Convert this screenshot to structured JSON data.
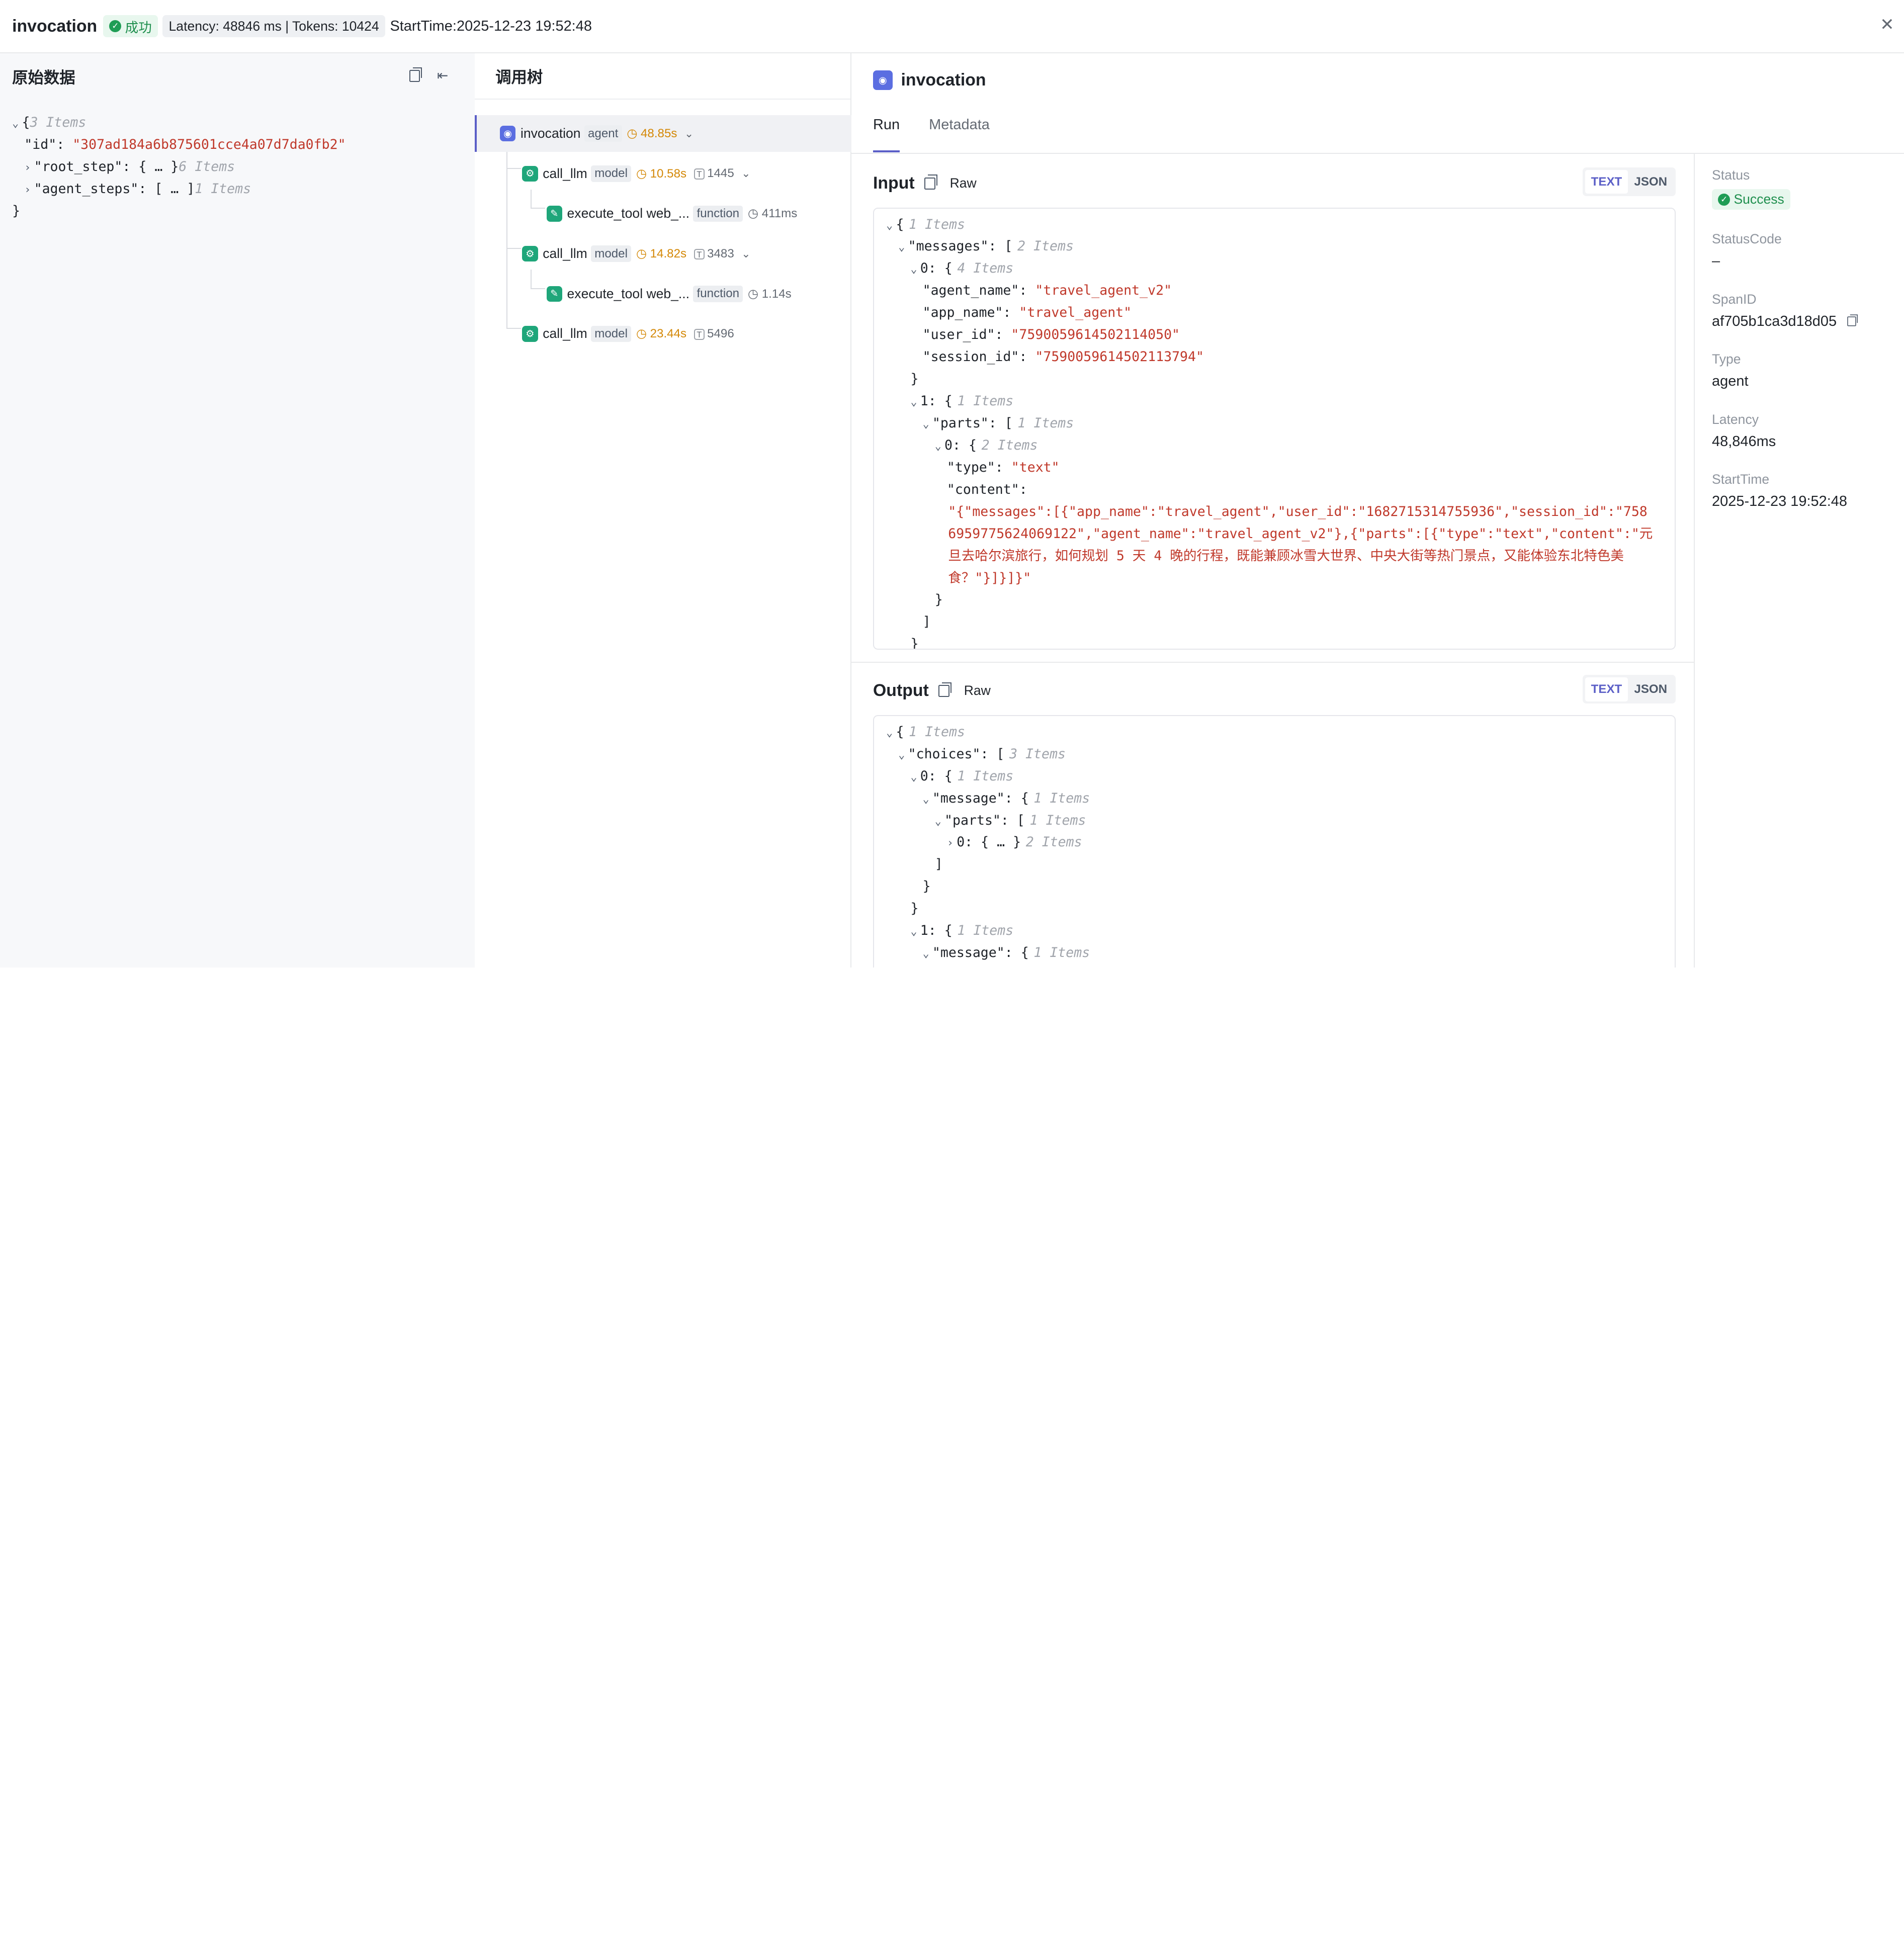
{
  "header": {
    "title": "invocation",
    "status": "成功",
    "metrics": "Latency: 48846 ms | Tokens: 10424",
    "start_time": "StartTime:2025-12-23 19:52:48",
    "close": "✕"
  },
  "raw": {
    "title": "原始数据",
    "lines": [
      {
        "tog": "⌄",
        "key": "{",
        "muted": "3 Items"
      },
      {
        "key": "\"id\": ",
        "str": "\"307ad184a6b875601cce4a07d7da0fb2\""
      },
      {
        "tog": "›",
        "key": "\"root_step\": { … }",
        "muted": "6 Items"
      },
      {
        "tog": "›",
        "key": "\"agent_steps\": [ … ]",
        "muted": "1 Items"
      },
      {
        "key": "}"
      }
    ]
  },
  "tree": {
    "title": "调用树",
    "nodes": [
      {
        "name": "invocation",
        "tag": "agent",
        "duration": "48.85s",
        "tokens": "",
        "icon": "agent-icon"
      },
      {
        "name": "call_llm",
        "tag": "model",
        "duration": "10.58s",
        "tokens": "1445",
        "icon": "model-icon"
      },
      {
        "name": "execute_tool web_...",
        "tag": "function",
        "duration": "411ms",
        "tokens": "",
        "icon": "tool-icon"
      },
      {
        "name": "call_llm",
        "tag": "model",
        "duration": "14.82s",
        "tokens": "3483",
        "icon": "model-icon"
      },
      {
        "name": "execute_tool web_...",
        "tag": "function",
        "duration": "1.14s",
        "tokens": "",
        "icon": "tool-icon"
      },
      {
        "name": "call_llm",
        "tag": "model",
        "duration": "23.44s",
        "tokens": "5496",
        "icon": "model-icon"
      }
    ]
  },
  "detail": {
    "title": "invocation",
    "tabs": [
      "Run",
      "Metadata"
    ],
    "input": {
      "label": "Input",
      "raw": "Raw",
      "text_btn": "TEXT",
      "json_btn": "JSON",
      "lines": [
        {
          "indent": 0,
          "tog": "⌄",
          "text": "{",
          "muted": "1 Items"
        },
        {
          "indent": 1,
          "tog": "⌄",
          "text": "\"messages\": [",
          "muted": "2 Items"
        },
        {
          "indent": 2,
          "tog": "⌄",
          "text": "0: {",
          "muted": "4 Items"
        },
        {
          "indent": 3,
          "key": "\"agent_name\": ",
          "str": "\"travel_agent_v2\""
        },
        {
          "indent": 3,
          "key": "\"app_name\": ",
          "str": "\"travel_agent\""
        },
        {
          "indent": 3,
          "key": "\"user_id\": ",
          "str": "\"7590059614502114050\""
        },
        {
          "indent": 3,
          "key": "\"session_id\": ",
          "str": "\"7590059614502113794\""
        },
        {
          "indent": 2,
          "text": "}"
        },
        {
          "indent": 2,
          "tog": "⌄",
          "text": "1: {",
          "muted": "1 Items"
        },
        {
          "indent": 3,
          "tog": "⌄",
          "text": "\"parts\": [",
          "muted": "1 Items"
        },
        {
          "indent": 4,
          "tog": "⌄",
          "text": "0: {",
          "muted": "2 Items"
        },
        {
          "indent": 5,
          "key": "\"type\": ",
          "str": "\"text\""
        },
        {
          "indent": 5,
          "key": "\"content\":"
        }
      ],
      "content_value": "\"{\"messages\":[{\"app_name\":\"travel_agent\",\"user_id\":\"1682715314755936\",\"session_id\":\"7586959775624069122\",\"agent_name\":\"travel_agent_v2\"},{\"parts\":[{\"type\":\"text\",\"content\":\"元旦去哈尔滨旅行，如何规划 5 天 4 晚的行程，既能兼顾冰雪大世界、中央大街等热门景点，又能体验东北特色美食？\"}]}]}\"",
      "tail": [
        {
          "indent": 4,
          "text": "}"
        },
        {
          "indent": 3,
          "text": "]"
        },
        {
          "indent": 2,
          "text": "}"
        },
        {
          "indent": 1,
          "text": "]"
        }
      ]
    },
    "output": {
      "label": "Output",
      "raw": "Raw",
      "text_btn": "TEXT",
      "json_btn": "JSON",
      "lines": [
        {
          "indent": 0,
          "tog": "⌄",
          "text": "{",
          "muted": "1 Items"
        },
        {
          "indent": 1,
          "tog": "⌄",
          "text": "\"choices\": [",
          "muted": "3 Items"
        },
        {
          "indent": 2,
          "tog": "⌄",
          "text": "0: {",
          "muted": "1 Items"
        },
        {
          "indent": 3,
          "tog": "⌄",
          "text": "\"message\": {",
          "muted": "1 Items"
        },
        {
          "indent": 4,
          "tog": "⌄",
          "text": "\"parts\": [",
          "muted": "1 Items"
        },
        {
          "indent": 5,
          "tog": "›",
          "text": "0: { … }",
          "muted": "2 Items"
        },
        {
          "indent": 4,
          "text": "]"
        },
        {
          "indent": 3,
          "text": "}"
        },
        {
          "indent": 2,
          "text": "}"
        },
        {
          "indent": 2,
          "tog": "⌄",
          "text": "1: {",
          "muted": "1 Items"
        },
        {
          "indent": 3,
          "tog": "⌄",
          "text": "\"message\": {",
          "muted": "1 Items"
        }
      ]
    },
    "meta": {
      "status_label": "Status",
      "status_value": "Success",
      "status_code_label": "StatusCode",
      "status_code_value": "–",
      "span_label": "SpanID",
      "span_value": "af705b1ca3d18d05",
      "type_label": "Type",
      "type_value": "agent",
      "latency_label": "Latency",
      "latency_value": "48,846ms",
      "start_label": "StartTime",
      "start_value": "2025-12-23 19:52:48"
    }
  },
  "colors": {
    "accent": "#5b5fc7",
    "string": "#c0392b",
    "success": "#1f9d55",
    "duration": "#d48806"
  }
}
